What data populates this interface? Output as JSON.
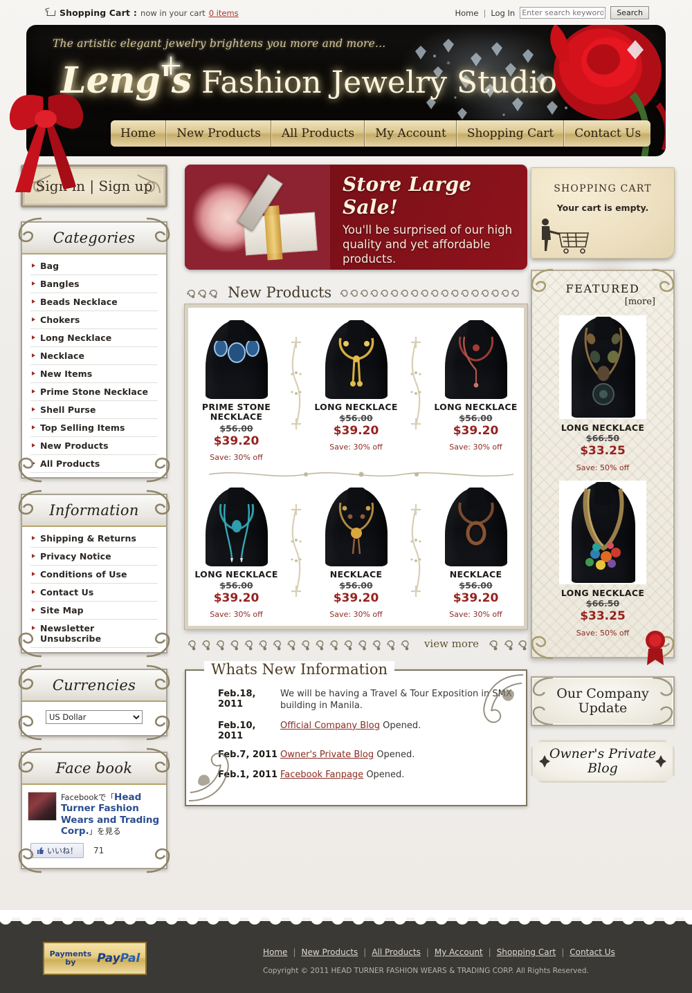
{
  "topbar": {
    "cart_icon": "shopping-cart-icon",
    "cart_label": "Shopping Cart",
    "cart_sep": ":",
    "cart_text": "now in your cart",
    "cart_items_link": "0 items",
    "home": "Home",
    "divider": "|",
    "login": "Log In",
    "search_placeholder": "Enter search keywords",
    "search_button": "Search"
  },
  "header": {
    "tagline": "The artistic elegant jewelry brightens you more and more...",
    "logo_script": "Leng's",
    "logo_rest": "Fashion Jewelry Studio",
    "nav": [
      {
        "label": "Home"
      },
      {
        "label": "New Products"
      },
      {
        "label": "All Products"
      },
      {
        "label": "My Account"
      },
      {
        "label": "Shopping Cart"
      },
      {
        "label": "Contact Us"
      }
    ]
  },
  "sidebar_left": {
    "signin_label": "Sign in | Sign up",
    "categories": {
      "title": "Categories",
      "items": [
        {
          "label": "Bag"
        },
        {
          "label": "Bangles"
        },
        {
          "label": "Beads Necklace"
        },
        {
          "label": "Chokers"
        },
        {
          "label": "Long Necklace"
        },
        {
          "label": "Necklace"
        },
        {
          "label": "New Items"
        },
        {
          "label": "Prime Stone Necklace"
        },
        {
          "label": "Shell Purse"
        },
        {
          "label": "Top Selling Items"
        },
        {
          "label": "New Products"
        },
        {
          "label": "All Products"
        }
      ]
    },
    "information": {
      "title": "Information",
      "items": [
        {
          "label": "Shipping & Returns"
        },
        {
          "label": "Privacy Notice"
        },
        {
          "label": "Conditions of Use"
        },
        {
          "label": "Contact Us"
        },
        {
          "label": "Site Map"
        },
        {
          "label": "Newsletter Unsubscribe"
        }
      ]
    },
    "currencies": {
      "title": "Currencies",
      "selected": "US Dollar",
      "options": [
        "US Dollar"
      ]
    },
    "facebook": {
      "title": "Face book",
      "text_pre": "Facebookで「",
      "page_name": "Head Turner Fashion Wears and Trading Corp.",
      "text_post": "」を見る",
      "like_label": "いいね！",
      "like_count": "71",
      "thumb_icon": "facebook-page-thumbnail"
    }
  },
  "promo": {
    "headline": "Store Large Sale!",
    "body": "You'll be surprised of our high quality and yet affordable products.",
    "image_icon": "gift-and-rose-photo"
  },
  "new_products": {
    "title": "New Products",
    "view_more": "view more",
    "items": [
      {
        "name": "PRIME STONE NECKLACE",
        "old_price": "$56.00",
        "price": "$39.20",
        "save": "Save: 30% off",
        "img": "blue-stone-necklace-on-mannequin"
      },
      {
        "name": "LONG NECKLACE",
        "old_price": "$56.00",
        "price": "$39.20",
        "save": "Save: 30% off",
        "img": "gold-tassel-necklace-on-mannequin"
      },
      {
        "name": "LONG NECKLACE",
        "old_price": "$56.00",
        "price": "$39.20",
        "save": "Save: 30% off",
        "img": "red-coral-necklace-on-mannequin"
      },
      {
        "name": "LONG NECKLACE",
        "old_price": "$56.00",
        "price": "$39.20",
        "save": "Save: 30% off",
        "img": "turquoise-necklace-on-mannequin"
      },
      {
        "name": "NECKLACE",
        "old_price": "$56.00",
        "price": "$39.20",
        "save": "Save: 30% off",
        "img": "amber-pendant-necklace-on-mannequin"
      },
      {
        "name": "NECKLACE",
        "old_price": "$56.00",
        "price": "$39.20",
        "save": "Save: 30% off",
        "img": "bronze-oval-pendant-necklace-on-mannequin"
      }
    ]
  },
  "whats_new": {
    "title": "Whats New Information",
    "rows": [
      {
        "date": "Feb.18, 2011",
        "text": "We will be having a Travel & Tour Exposition in SMX building in Manila.",
        "link": ""
      },
      {
        "date": "Feb.10, 2011",
        "link": "Official Company Blog",
        "text": " Opened."
      },
      {
        "date": "Feb.7, 2011",
        "link": "Owner's Private Blog",
        "text": " Opened."
      },
      {
        "date": "Feb.1, 2011",
        "link": "Facebook Fanpage",
        "text": " Opened."
      }
    ]
  },
  "sidebar_right": {
    "cart": {
      "title": "SHOPPING CART",
      "empty_text": "Your cart is empty.",
      "icon": "woman-with-cart-silhouette"
    },
    "featured": {
      "title": "FEATURED",
      "more": "[more]",
      "items": [
        {
          "name": "LONG NECKLACE",
          "old_price": "$66.50",
          "price": "$33.25",
          "save": "Save: 50% off",
          "img": "stone-bead-long-necklace-on-mannequin"
        },
        {
          "name": "LONG NECKLACE",
          "old_price": "$66.50",
          "price": "$33.25",
          "save": "Save: 50% off",
          "img": "multicolor-bead-long-necklace-on-mannequin"
        }
      ]
    },
    "company_update": "Our Company Update",
    "owners_blog": "Owner's Private Blog"
  },
  "footer": {
    "paypal_line1": "Payments",
    "paypal_line2": "by",
    "paypal_brand_a": "Pay",
    "paypal_brand_b": "Pal",
    "nav": [
      {
        "label": "Home"
      },
      {
        "label": "New Products"
      },
      {
        "label": "All Products"
      },
      {
        "label": "My Account"
      },
      {
        "label": "Shopping Cart"
      },
      {
        "label": "Contact Us"
      }
    ],
    "separator": "|",
    "copyright": "Copyright © 2011 HEAD TURNER FASHION WEARS & TRADING CORP. All Rights Reserved."
  },
  "colors": {
    "accent_gold": "#c6ad6a",
    "price_red": "#96221e",
    "link_red": "#8a2b22",
    "footer_bg": "#3b3935",
    "banner_red": "#8e131c"
  }
}
